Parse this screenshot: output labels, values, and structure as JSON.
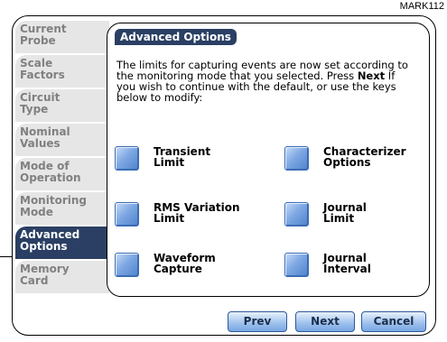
{
  "doc_id": "MARK112",
  "sidebar": {
    "items": [
      {
        "l1": "Current",
        "l2": "Probe",
        "active": false
      },
      {
        "l1": "Scale",
        "l2": "Factors",
        "active": false
      },
      {
        "l1": "Circuit",
        "l2": "Type",
        "active": false
      },
      {
        "l1": "Nominal",
        "l2": "Values",
        "active": false
      },
      {
        "l1": "Mode of",
        "l2": "Operation",
        "active": false
      },
      {
        "l1": "Monitoring",
        "l2": "Mode",
        "active": false
      },
      {
        "l1": "Advanced",
        "l2": "Options",
        "active": true
      },
      {
        "l1": "Memory",
        "l2": "Card",
        "active": false
      }
    ]
  },
  "panel": {
    "title": "Advanced Options",
    "desc_before": "The limits for capturing events are now set according to the monitoring mode that you selected. Press ",
    "desc_bold": "Next",
    "desc_after": " If you wish to continue with the default, or use the keys below to modify:"
  },
  "options": {
    "transient": {
      "l1": "Transient",
      "l2": "Limit"
    },
    "characterizer": {
      "l1": "Characterizer",
      "l2": "Options"
    },
    "rms": {
      "l1": "RMS Variation",
      "l2": "Limit"
    },
    "journal_limit": {
      "l1": "Journal",
      "l2": "Limit"
    },
    "waveform": {
      "l1": "Waveform",
      "l2": "Capture"
    },
    "journal_interval": {
      "l1": "Journal",
      "l2": "Interval"
    }
  },
  "footer": {
    "prev": "Prev",
    "next": "Next",
    "cancel": "Cancel"
  },
  "colors": {
    "accent": "#2a3f63",
    "button_blue": "#7ea8e3",
    "sidebar_inactive_bg": "#e6e6e6",
    "sidebar_inactive_text": "#808080"
  }
}
